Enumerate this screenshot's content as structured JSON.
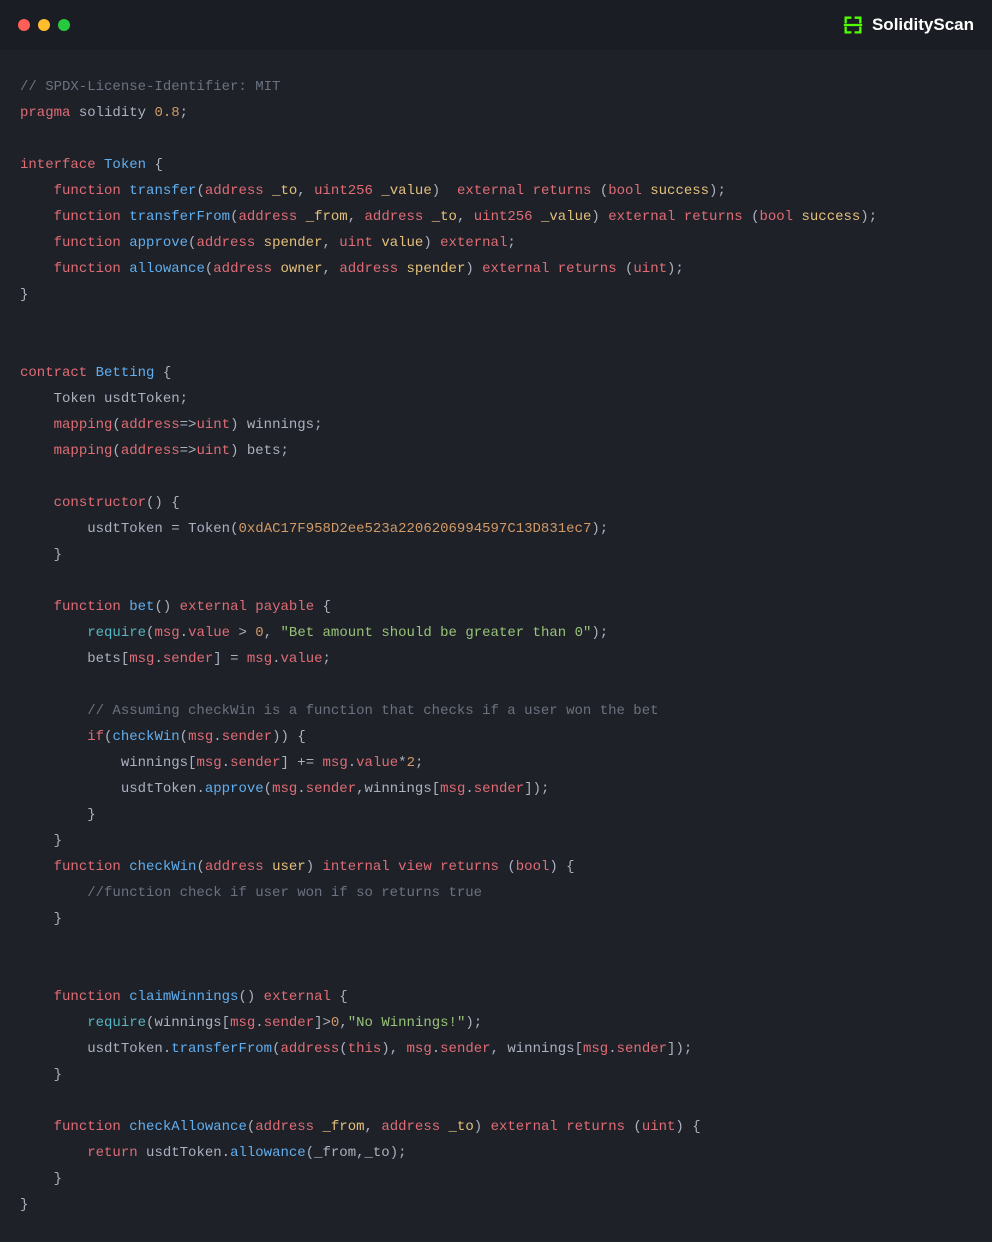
{
  "brand": {
    "name": "SolidityScan"
  },
  "code": {
    "license": "// SPDX-License-Identifier: MIT",
    "pragma_kw": "pragma",
    "solidity_kw": "solidity",
    "version": "0.8",
    "interface_kw": "interface",
    "token_name": "Token",
    "function_kw": "function",
    "transfer_name": "transfer",
    "address_type": "address",
    "uint256_type": "uint256",
    "uint_type": "uint",
    "bool_type": "bool",
    "to_param": "_to",
    "value_param": "_value",
    "from_param": "_from",
    "external_kw": "external",
    "returns_kw": "returns",
    "success_param": "success",
    "transferFrom_name": "transferFrom",
    "approve_name": "approve",
    "spender_param": "spender",
    "value_param2": "value",
    "allowance_name": "allowance",
    "owner_param": "owner",
    "contract_kw": "contract",
    "betting_name": "Betting",
    "usdtToken_var": "usdtToken",
    "mapping_kw": "mapping",
    "winnings_var": "winnings",
    "bets_var": "bets",
    "constructor_kw": "constructor",
    "token_addr": "0xdAC17F958D2ee523a2206206994597C13D831ec7",
    "bet_name": "bet",
    "payable_kw": "payable",
    "require_kw": "require",
    "msg_kw": "msg",
    "value_prop": "value",
    "sender_prop": "sender",
    "zero": "0",
    "bet_err": "\"Bet amount should be greater than 0\"",
    "checkwin_comment": "// Assuming checkWin is a function that checks if a user won the bet",
    "if_kw": "if",
    "checkWin_name": "checkWin",
    "two": "2",
    "user_param": "user",
    "internal_kw": "internal",
    "view_kw": "view",
    "checkwin_body_comment": "//function check if user won if so returns true",
    "claimWinnings_name": "claimWinnings",
    "no_winnings_err": "\"No Winnings!\"",
    "this_kw": "this",
    "checkAllowance_name": "checkAllowance",
    "return_kw": "return"
  }
}
